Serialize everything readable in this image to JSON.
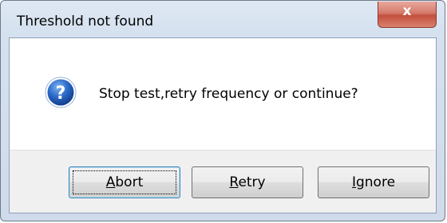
{
  "window": {
    "title": "Threshold not found",
    "close_glyph": "x"
  },
  "message": {
    "icon": "question-icon",
    "text": "Stop test,retry frequency or continue?"
  },
  "buttons": {
    "abort": {
      "accel": "A",
      "rest": "bort",
      "label": "Abort"
    },
    "retry": {
      "accel": "R",
      "rest": "etry",
      "label": "Retry"
    },
    "ignore": {
      "accel": "I",
      "rest": "gnore",
      "label": "Ignore"
    }
  },
  "colors": {
    "close_button": "#c24f3d",
    "icon_blue": "#1f5fc4"
  }
}
